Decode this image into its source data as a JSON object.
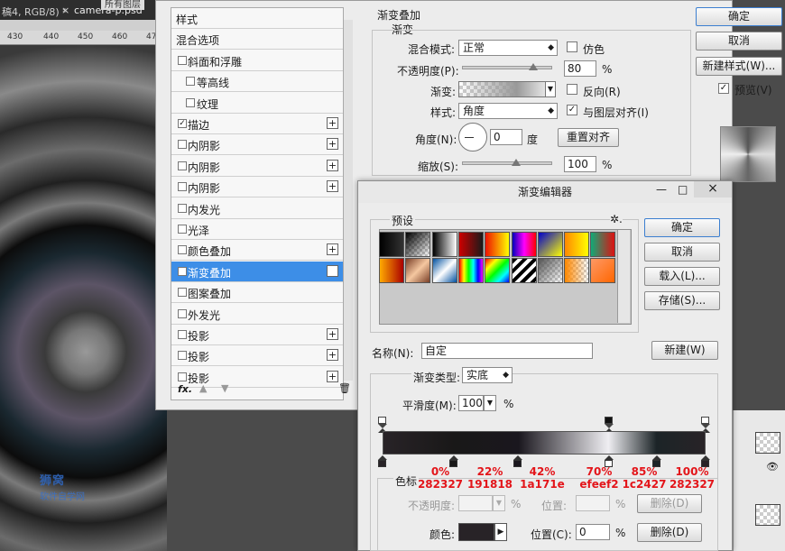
{
  "ps": {
    "tab_left": "稿4, RGB/8) *",
    "tab_close": "×",
    "tab_file": "camera-p.psd",
    "layer_mode_fragment": "所有图层",
    "ruler": [
      "430",
      "440",
      "450",
      "460",
      "470"
    ],
    "watermark_title": "狮窝",
    "watermark_sub": "软件自学网"
  },
  "layer_style": {
    "list": [
      {
        "label": "样式",
        "cb": false,
        "checked": false,
        "plus": false
      },
      {
        "label": "混合选项",
        "cb": false,
        "checked": false,
        "plus": false
      },
      {
        "label": "斜面和浮雕",
        "cb": true,
        "checked": false,
        "plus": false
      },
      {
        "label": "等高线",
        "cb": true,
        "checked": false,
        "plus": false,
        "indent": true
      },
      {
        "label": "纹理",
        "cb": true,
        "checked": false,
        "plus": false,
        "indent": true
      },
      {
        "label": "描边",
        "cb": true,
        "checked": true,
        "plus": true
      },
      {
        "label": "内阴影",
        "cb": true,
        "checked": false,
        "plus": true
      },
      {
        "label": "内阴影",
        "cb": true,
        "checked": false,
        "plus": true
      },
      {
        "label": "内阴影",
        "cb": true,
        "checked": false,
        "plus": true
      },
      {
        "label": "内发光",
        "cb": true,
        "checked": false,
        "plus": false
      },
      {
        "label": "光泽",
        "cb": true,
        "checked": false,
        "plus": false
      },
      {
        "label": "颜色叠加",
        "cb": true,
        "checked": false,
        "plus": true
      },
      {
        "label": "渐变叠加",
        "cb": true,
        "checked": true,
        "plus": true,
        "selected": true
      },
      {
        "label": "图案叠加",
        "cb": true,
        "checked": false,
        "plus": false
      },
      {
        "label": "外发光",
        "cb": true,
        "checked": false,
        "plus": false
      },
      {
        "label": "投影",
        "cb": true,
        "checked": false,
        "plus": true
      },
      {
        "label": "投影",
        "cb": true,
        "checked": false,
        "plus": true
      },
      {
        "label": "投影",
        "cb": true,
        "checked": false,
        "plus": true
      }
    ],
    "fx_label": "fx."
  },
  "gradient_overlay": {
    "title": "渐变叠加",
    "subtitle": "渐变",
    "blend_mode_label": "混合模式:",
    "blend_mode_value": "正常",
    "dither_label": "仿色",
    "opacity_label": "不透明度(P):",
    "opacity_value": "80",
    "pct": "%",
    "gradient_label": "渐变:",
    "reverse_label": "反向(R)",
    "style_label": "样式:",
    "style_value": "角度",
    "align_label": "与图层对齐(I)",
    "angle_label": "角度(N):",
    "angle_value": "0",
    "degree": "度",
    "reset_align": "重置对齐",
    "scale_label": "缩放(S):",
    "scale_value": "100"
  },
  "main_buttons": {
    "ok": "确定",
    "cancel": "取消",
    "new_style": "新建样式(W)...",
    "preview": "预览(V)"
  },
  "gradient_editor": {
    "title": "渐变编辑器",
    "min": "—",
    "max": "□",
    "close": "×",
    "presets_label": "预设",
    "gear": "✲.",
    "ok": "确定",
    "cancel": "取消",
    "load": "载入(L)...",
    "save": "存储(S)...",
    "name_label": "名称(N):",
    "name_value": "自定",
    "new": "新建(W)",
    "type_label": "渐变类型:",
    "type_value": "实底",
    "smooth_label": "平滑度(M):",
    "smooth_value": "100",
    "pct": "%",
    "stops_label": "色标",
    "opacity_label": "不透明度:",
    "location_label": "位置:",
    "delete_label": "删除(D)",
    "color_label": "颜色:",
    "color_location_label": "位置(C):",
    "color_location_value": "0",
    "color_delete_label": "删除(D)"
  },
  "stops": [
    {
      "pct_label": "0%",
      "hex_label": "282327",
      "pos": 0,
      "color": "#282327"
    },
    {
      "pct_label": "22%",
      "hex_label": "191818",
      "pos": 22,
      "color": "#191818"
    },
    {
      "pct_label": "42%",
      "hex_label": "1a171e",
      "pos": 42,
      "color": "#1a171e"
    },
    {
      "pct_label": "70%",
      "hex_label": "efeef2",
      "pos": 70,
      "color": "#efeef2"
    },
    {
      "pct_label": "85%",
      "hex_label": "1c2427",
      "pos": 85,
      "color": "#1c2427"
    },
    {
      "pct_label": "100%",
      "hex_label": "282327",
      "pos": 100,
      "color": "#282327"
    }
  ],
  "opacity_stops": [
    0,
    70,
    100
  ],
  "colors": {
    "accent": "#3d8ee7",
    "annotation": "#e3151a"
  }
}
